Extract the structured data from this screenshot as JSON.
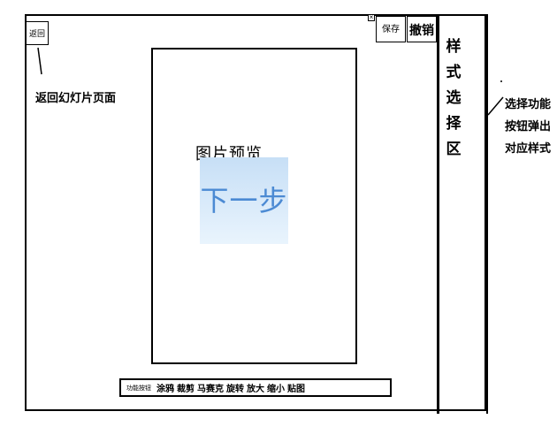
{
  "header": {
    "back_label": "返回",
    "save_label": "保存",
    "undo_label": "撤销",
    "close_glyph": "×"
  },
  "preview": {
    "label": "图片预览",
    "next_label": "下一步"
  },
  "style_panel": {
    "title": "样式选择区"
  },
  "toolbar": {
    "label": "功能按钮",
    "items": [
      "涂鸦",
      "裁剪",
      "马赛克",
      "旋转",
      "放大",
      "缩小",
      "贴图"
    ]
  },
  "annotations": {
    "left": "返回幻灯片页面",
    "right": "选择功能按钮弹出对应样式"
  },
  "colors": {
    "next_button_text": "#4b8ad3",
    "next_button_bg_top": "#c7dff6",
    "next_button_bg_bottom": "#e9f4fd"
  }
}
